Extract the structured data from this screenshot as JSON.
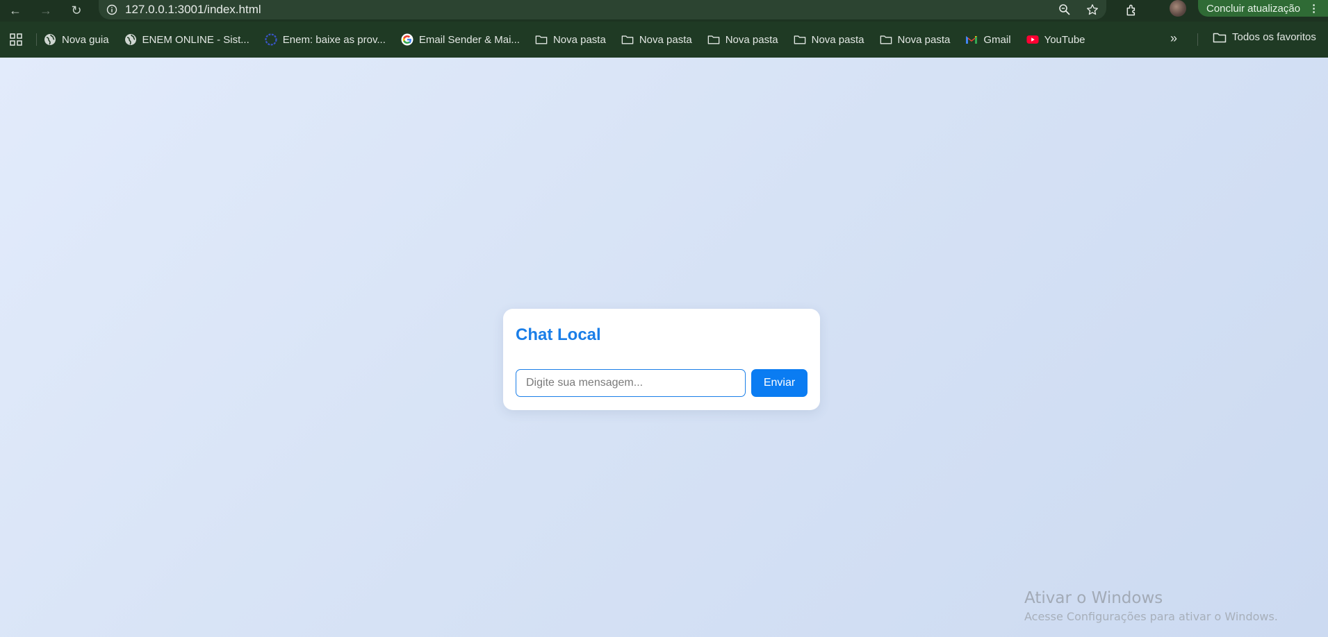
{
  "browser": {
    "url": "127.0.0.1:3001/index.html",
    "update_label": "Concluir atualização",
    "update_menu_glyph": "⋮",
    "back_glyph": "←",
    "forward_glyph": "→",
    "reload_glyph": "↻"
  },
  "bookmarks": {
    "items": [
      {
        "label": "Nova guia",
        "icon": "globe-icon"
      },
      {
        "label": "ENEM ONLINE - Sist...",
        "icon": "globe-icon"
      },
      {
        "label": "Enem: baixe as prov...",
        "icon": "enem-icon"
      },
      {
        "label": "Email Sender & Mai...",
        "icon": "google-icon"
      },
      {
        "label": "Nova pasta",
        "icon": "folder-icon"
      },
      {
        "label": "Nova pasta",
        "icon": "folder-icon"
      },
      {
        "label": "Nova pasta",
        "icon": "folder-icon"
      },
      {
        "label": "Nova pasta",
        "icon": "folder-icon"
      },
      {
        "label": "Nova pasta",
        "icon": "folder-icon"
      },
      {
        "label": "Gmail",
        "icon": "gmail-icon"
      },
      {
        "label": "YouTube",
        "icon": "youtube-icon"
      }
    ],
    "more_glyph": "»",
    "all_label": "Todos os favoritos"
  },
  "chat": {
    "title": "Chat Local",
    "input_placeholder": "Digite sua mensagem...",
    "input_value": "",
    "send_label": "Enviar"
  },
  "watermark": {
    "title": "Ativar o Windows",
    "subtitle": "Acesse Configurações para ativar o Windows."
  },
  "colors": {
    "accent": "#1a7ee8",
    "button": "#0a7cf2",
    "chrome": "#1f3a24",
    "update_button": "#2f6b35"
  }
}
